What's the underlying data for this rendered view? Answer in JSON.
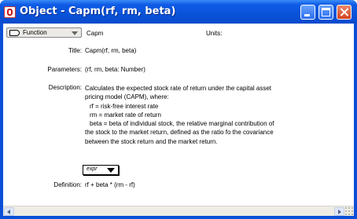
{
  "window": {
    "title": "Object - Capm(rf, rm, beta)",
    "colors": {
      "titlebar": "#0a4fd8",
      "close_button": "#d4421f",
      "client_bg": "#ffffff"
    }
  },
  "header": {
    "class_select_label": "Function",
    "identifier": "Capm",
    "units_label": "Units:"
  },
  "fields": {
    "title_label": "Title:",
    "title_value": "Capm(rf, rm, beta)",
    "parameters_label": "Parameters:",
    "parameters_value": "(rf, rm, beta: Number)",
    "description_label": "Description:",
    "description_lines": [
      "Calculates the expected stock rate of return under the capital asset",
      "pricing model (CAPM), where:",
      "rf = risk-free interest rate",
      "rm = market rate of return",
      "beta = beta of individual stock, the relative marginal contribution of",
      "the stock to the market return, defined as the ratio fo the covariance",
      "between the stock return and the market return."
    ],
    "expr_select_label": "expr",
    "definition_label": "Definition:",
    "definition_value": "rf + beta * (rm - rf)"
  },
  "icons": [
    "app-icon",
    "minimize-icon",
    "maximize-icon",
    "close-icon",
    "function-node-icon",
    "chevron-down-icon",
    "scroll-left-icon",
    "scroll-right-icon",
    "resize-grip-icon"
  ]
}
